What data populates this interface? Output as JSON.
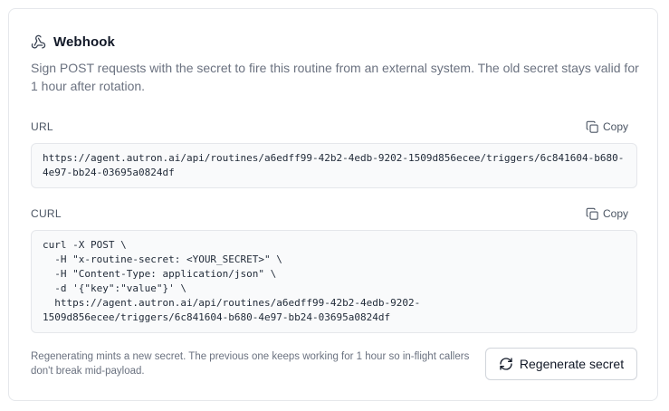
{
  "webhook": {
    "title": "Webhook",
    "icon": "webhook-icon",
    "description": "Sign POST requests with the secret to fire this routine from an external system. The old secret stays valid for 1 hour after rotation."
  },
  "url_section": {
    "label": "URL",
    "copy_label": "Copy",
    "value": "https://agent.autron.ai/api/routines/a6edff99-42b2-4edb-9202-1509d856ecee/triggers/6c841604-b680-4e97-bb24-03695a0824df"
  },
  "curl_section": {
    "label": "CURL",
    "copy_label": "Copy",
    "value": "curl -X POST \\\n  -H \"x-routine-secret: <YOUR_SECRET>\" \\\n  -H \"Content-Type: application/json\" \\\n  -d '{\"key\":\"value\"}' \\\n  https://agent.autron.ai/api/routines/a6edff99-42b2-4edb-9202-\n1509d856ecee/triggers/6c841604-b680-4e97-bb24-03695a0824df"
  },
  "footer": {
    "note": "Regenerating mints a new secret. The previous one keeps working for 1 hour so in-flight callers don't break mid-payload.",
    "regenerate_label": "Regenerate secret"
  }
}
